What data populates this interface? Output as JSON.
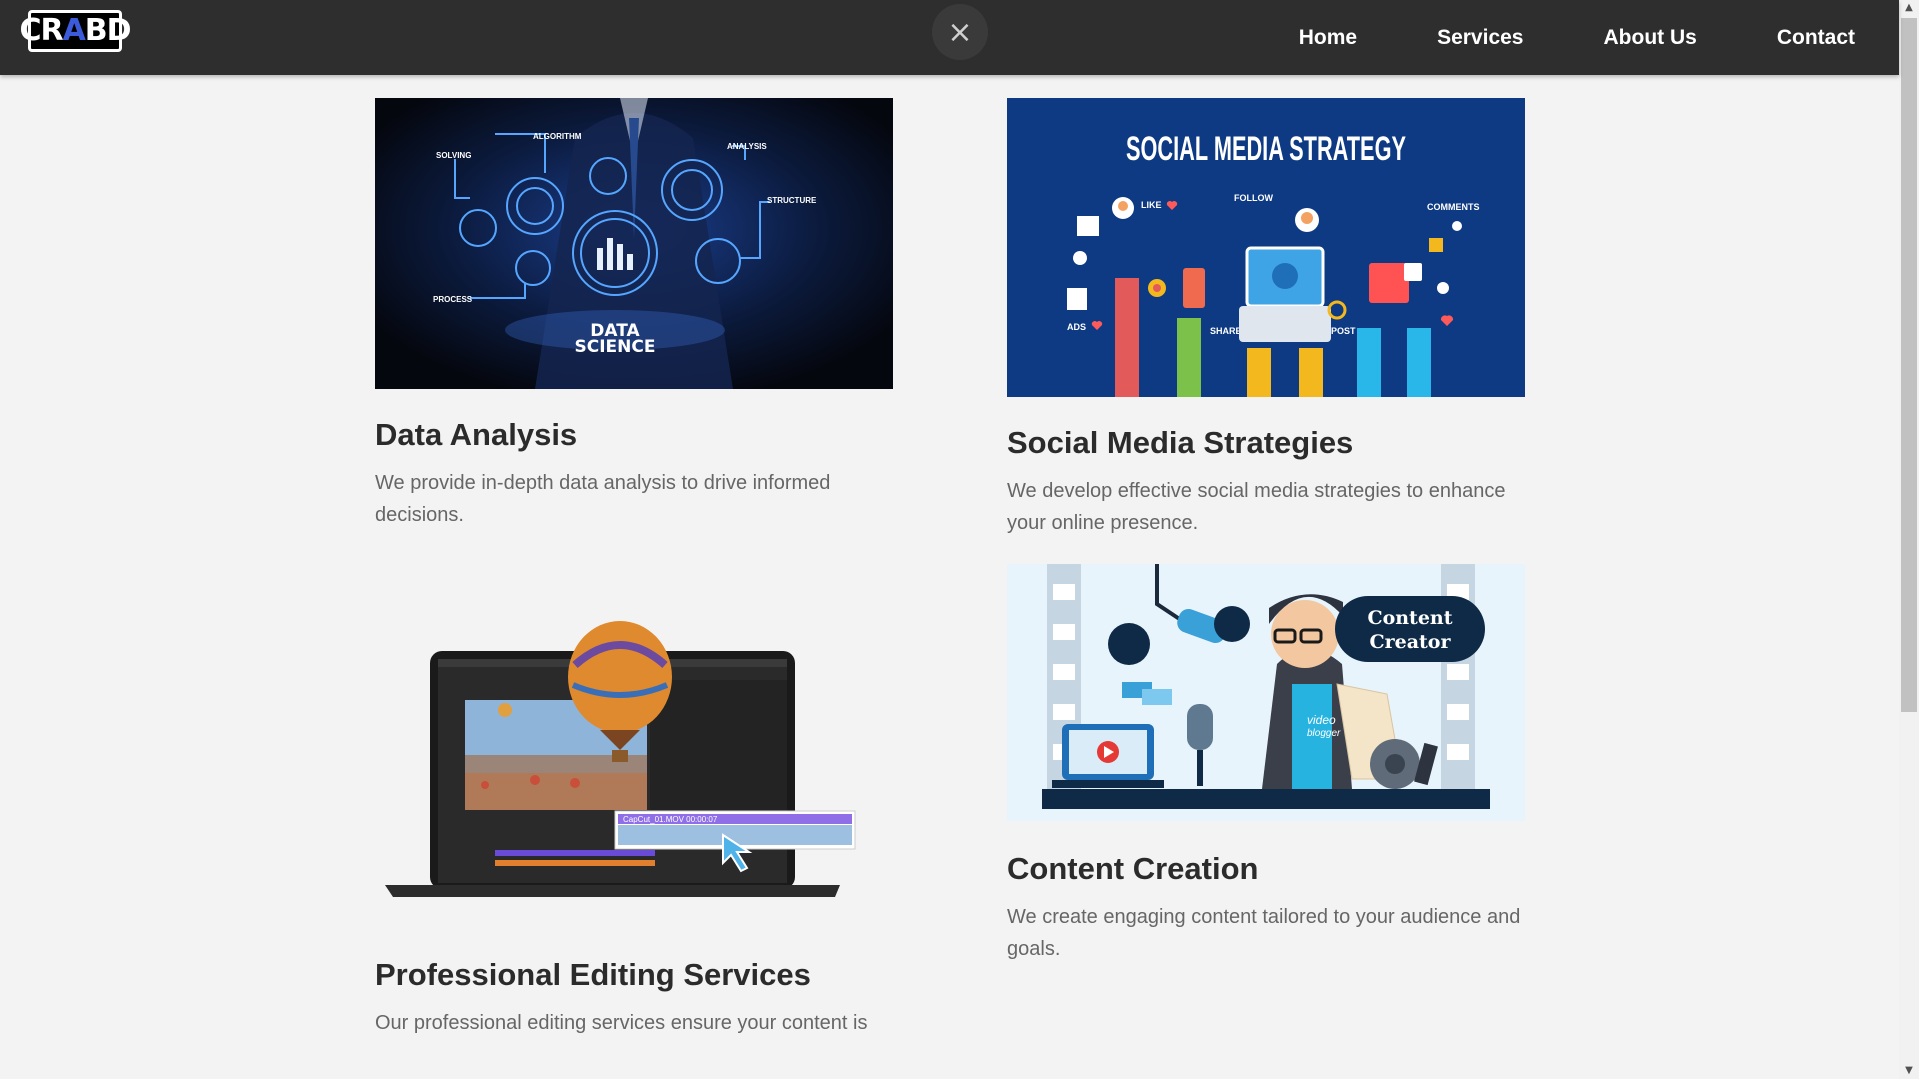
{
  "header": {
    "logo": {
      "part1": "CR",
      "part2": "A",
      "part3": "BD"
    },
    "close_icon": "×",
    "nav": [
      "Home",
      "Services",
      "About Us",
      "Contact"
    ]
  },
  "services": [
    {
      "title": "Data Analysis",
      "description": "We provide in-depth data analysis to drive informed decisions.",
      "image": {
        "labels": [
          "SOLVING",
          "ALGORITHM",
          "ANALYSIS",
          "STRUCTURE",
          "PROCESS"
        ],
        "caption_line1": "DATA",
        "caption_line2": "SCIENCE"
      }
    },
    {
      "title": "Social Media Strategies",
      "description": "We develop effective social media strategies to enhance your online presence.",
      "image": {
        "heading": "SOCIAL MEDIA STRATEGY",
        "labels": [
          "LIKE",
          "FOLLOW",
          "COMMENTS",
          "ADS",
          "SHARE",
          "POST"
        ]
      }
    },
    {
      "title": "Professional Editing Services",
      "description": "Our professional editing services ensure your content is",
      "image": {
        "clip_label": "CapCut_01.MOV  00:00:07"
      }
    },
    {
      "title": "Content Creation",
      "description": "We create engaging content tailored to your audience and goals.",
      "image": {
        "badge_line1": "Content",
        "badge_line2": "Creator",
        "shirt_line1": "video",
        "shirt_line2": "blogger"
      }
    }
  ],
  "colors": {
    "navbar": "#2e2e2e",
    "page_bg": "#f3f3f3",
    "logo_accent": "#3b5bdb",
    "social_bg": "#0d3a82"
  }
}
